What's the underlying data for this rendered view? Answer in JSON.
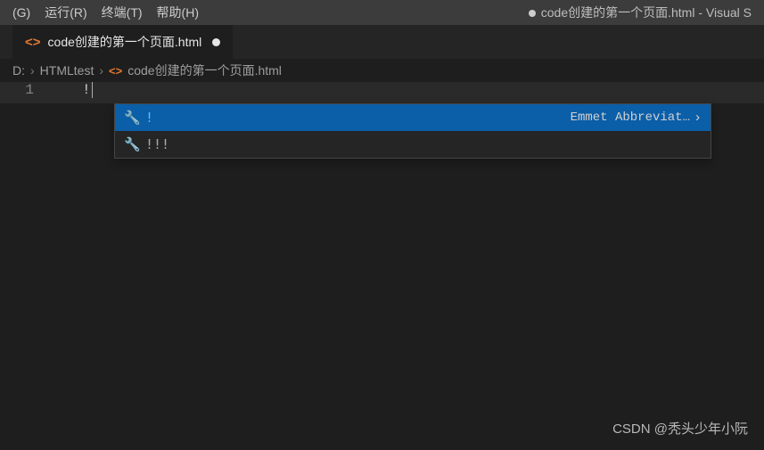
{
  "menubar": {
    "items": [
      "(G)",
      "运行(R)",
      "终端(T)",
      "帮助(H)"
    ],
    "window_title": "code创建的第一个页面.html - Visual S"
  },
  "tab": {
    "filename": "code创建的第一个页面.html",
    "dirty": true
  },
  "breadcrumbs": {
    "parts": [
      "D:",
      "HTMLtest",
      "code创建的第一个页面.html"
    ]
  },
  "editor": {
    "line_number": "1",
    "typed": "!"
  },
  "suggest": {
    "items": [
      {
        "label": "!",
        "desc": "Emmet Abbreviat…",
        "selected": true
      },
      {
        "label": "!!!",
        "desc": "",
        "selected": false
      }
    ]
  },
  "watermark": "CSDN @秃头少年小阮"
}
